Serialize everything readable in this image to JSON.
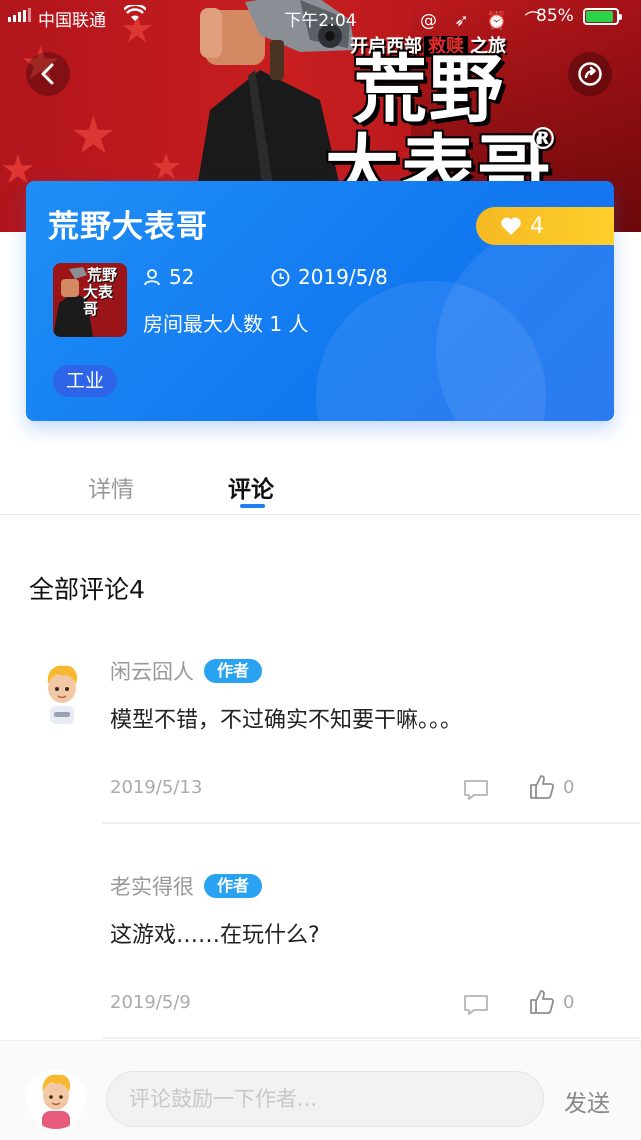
{
  "status_bar": {
    "carrier": "中国联通",
    "time": "下午2:04",
    "battery": "85%",
    "battery_level": 0.85
  },
  "banner": {
    "subtitle_prefix": "开启西部",
    "subtitle_highlight": "救赎",
    "subtitle_suffix": "之旅",
    "title_line1": "荒野",
    "title_line2": "大表哥",
    "registered": "®"
  },
  "header": {
    "back_icon": "chevron-left-icon",
    "share_icon": "share-icon"
  },
  "game": {
    "title": "荒野大表哥",
    "likes": "4",
    "players": "52",
    "date": "2019/5/8",
    "room_info": "房间最大人数 1 人",
    "tag": "工业",
    "thumb_title_line1": "荒野",
    "thumb_title_line2": "大表哥",
    "accent_color": "#1a7ff3",
    "like_color": "#f7c027"
  },
  "tabs": [
    {
      "label": "详情",
      "active": false
    },
    {
      "label": "评论",
      "active": true
    }
  ],
  "comments_section": {
    "title": "全部评论4"
  },
  "comments": [
    {
      "author": "闲云囧人",
      "badge": "作者",
      "text": "模型不错，不过确实不知要干嘛。。。",
      "date": "2019/5/13",
      "likes": "0"
    },
    {
      "author": "老实得很",
      "badge": "作者",
      "text": "这游戏……在玩什么?",
      "date": "2019/5/9",
      "likes": "0"
    }
  ],
  "input_bar": {
    "placeholder": "评论鼓励一下作者...",
    "send_label": "发送"
  }
}
